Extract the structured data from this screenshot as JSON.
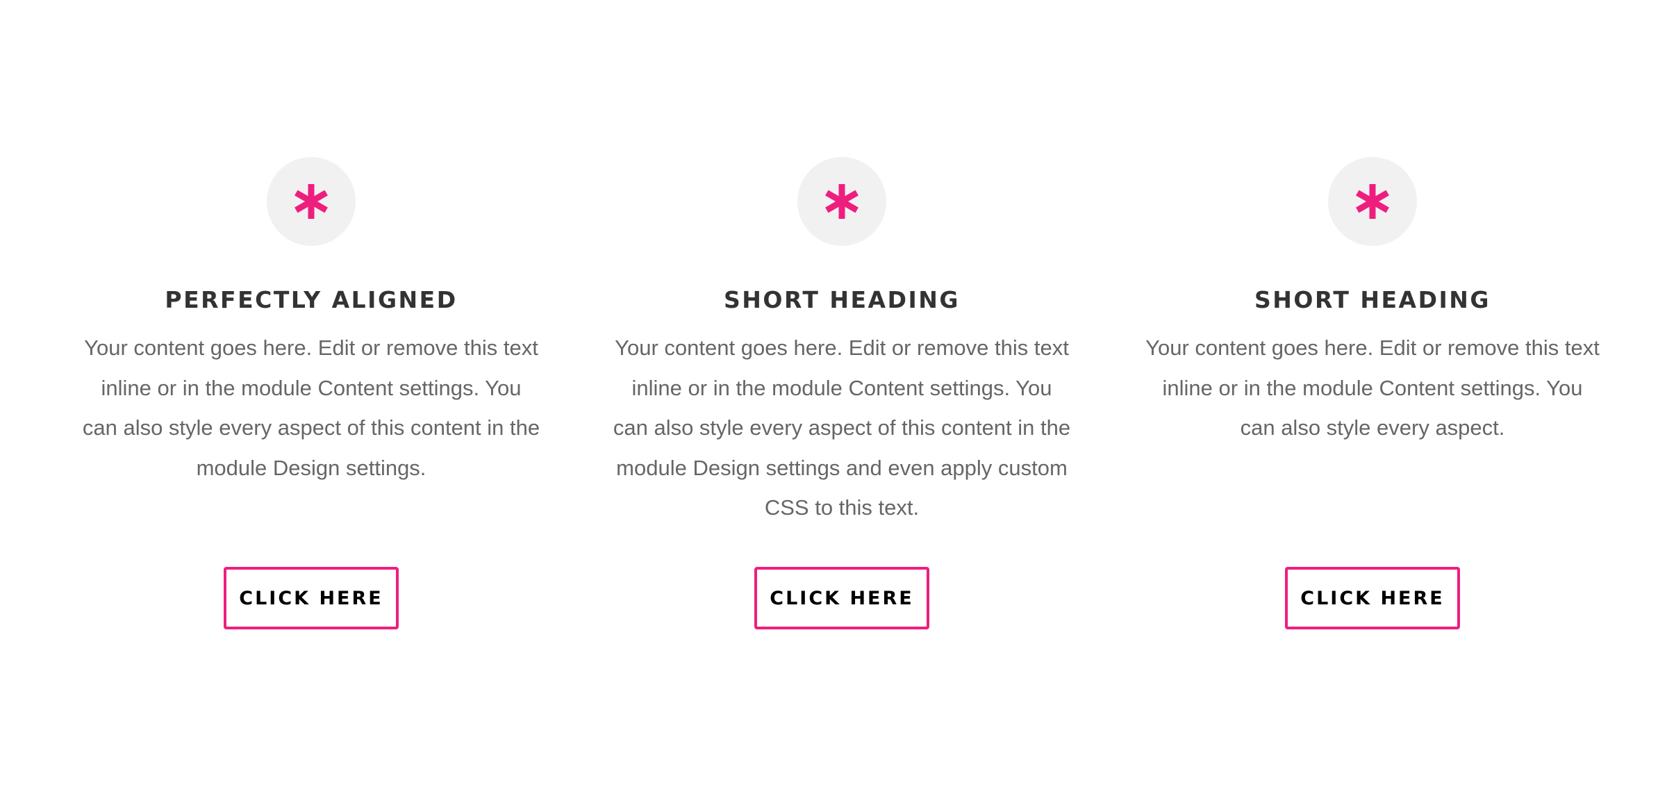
{
  "theme": {
    "accent_color": "#ee1e7f",
    "icon_bg_color": "#f1f1f1",
    "heading_color": "#333333",
    "text_color": "#666666"
  },
  "blurbs": [
    {
      "icon": "asterisk-icon",
      "heading": "PERFECTLY ALIGNED",
      "text": "Your content goes here. Edit or remove this text inline or in the module Content settings. You can also style every aspect of this content in the module Design settings.",
      "button_label": "CLICK HERE"
    },
    {
      "icon": "asterisk-icon",
      "heading": "SHORT HEADING",
      "text": "Your content goes here. Edit or remove this text inline or in the module Content settings. You can also style every aspect of this content in the module Design settings and even apply custom CSS to this text.",
      "button_label": "CLICK HERE"
    },
    {
      "icon": "asterisk-icon",
      "heading": "SHORT HEADING",
      "text": "Your content goes here. Edit or remove this text inline or in the module Content settings. You can also style every aspect.",
      "button_label": "CLICK HERE"
    }
  ]
}
